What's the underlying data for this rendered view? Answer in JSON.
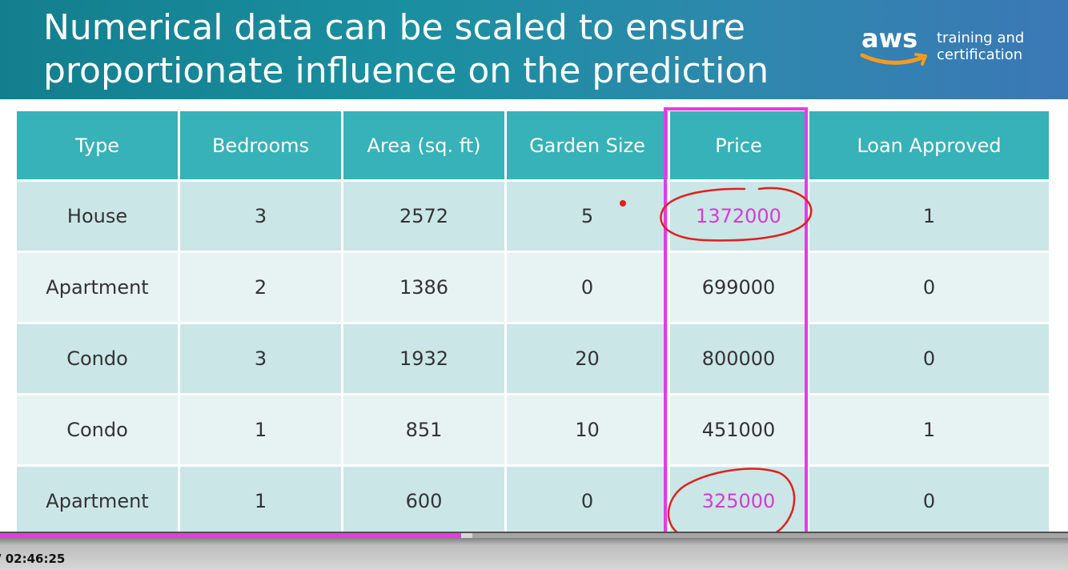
{
  "slide": {
    "title": "Numerical data can be scaled to ensure\nproportionate influence on the prediction",
    "brand": {
      "logo_word": "aws",
      "tagline": "training and\ncertification"
    }
  },
  "table": {
    "columns": [
      "Type",
      "Bedrooms",
      "Area (sq. ft)",
      "Garden Size",
      "Price",
      "Loan Approved"
    ],
    "rows": [
      [
        "House",
        "3",
        "2572",
        "5",
        "1372000",
        "1"
      ],
      [
        "Apartment",
        "2",
        "1386",
        "0",
        "699000",
        "0"
      ],
      [
        "Condo",
        "3",
        "1932",
        "20",
        "800000",
        "0"
      ],
      [
        "Condo",
        "1",
        "851",
        "10",
        "451000",
        "1"
      ],
      [
        "Apartment",
        "1",
        "600",
        "0",
        "325000",
        "0"
      ]
    ],
    "highlighted_column": "Price",
    "circled_values": [
      "1372000",
      "325000"
    ]
  },
  "player": {
    "timestamp": "/ 02:46:25",
    "progress_fraction": 0.432
  },
  "colors": {
    "header_teal": "#36b2b8",
    "highlight_magenta": "#d63ad6",
    "annotation_red": "#e0201e",
    "progress_magenta": "#e43ce4"
  }
}
